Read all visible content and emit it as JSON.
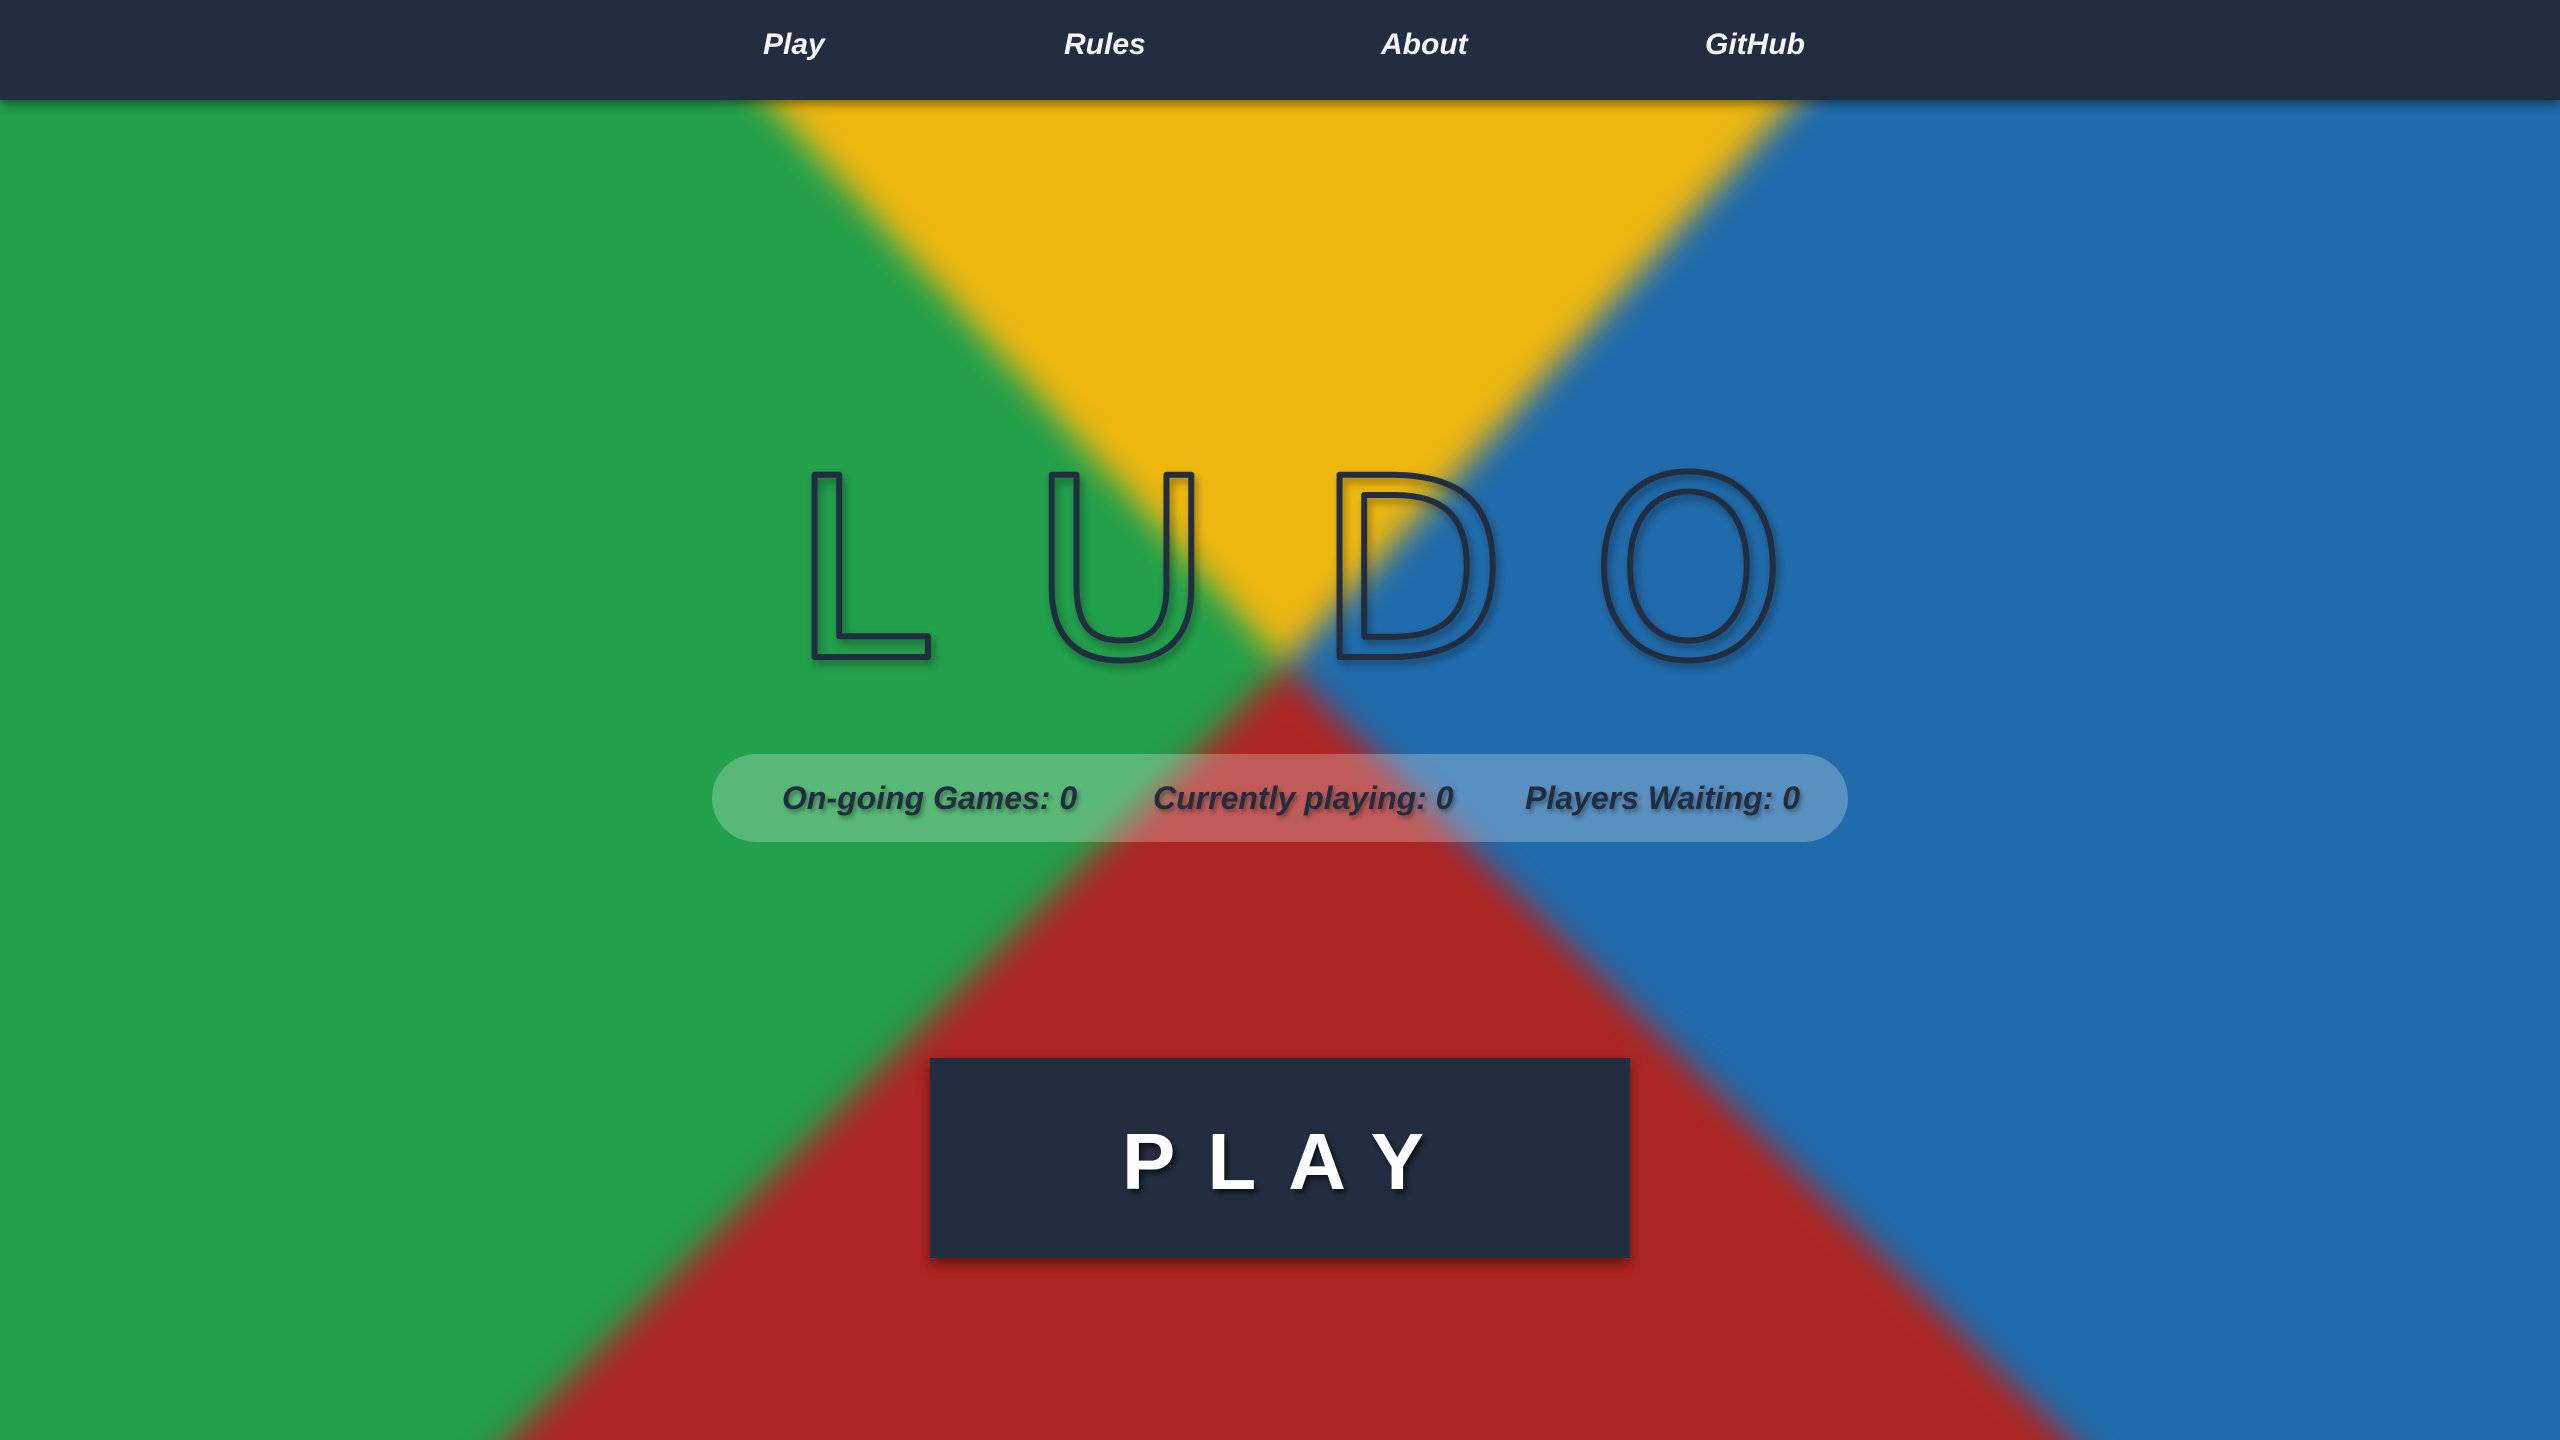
{
  "nav": {
    "items": [
      {
        "label": "Play"
      },
      {
        "label": "Rules"
      },
      {
        "label": "About"
      },
      {
        "label": "GitHub"
      }
    ]
  },
  "logo": {
    "letters": [
      "L",
      "U",
      "D",
      "O"
    ]
  },
  "stats": {
    "ongoing_games": "On-going Games: 0",
    "currently_playing": "Currently playing: 0",
    "players_waiting": "Players Waiting: 0"
  },
  "play_button": {
    "label": "PLAY"
  },
  "colors": {
    "navbar": "#222e3f",
    "green": "#22a04b",
    "yellow": "#edb710",
    "blue": "#206bab",
    "red": "#ad2522",
    "dark_text": "#222e3f",
    "light_text": "#ffffff"
  }
}
